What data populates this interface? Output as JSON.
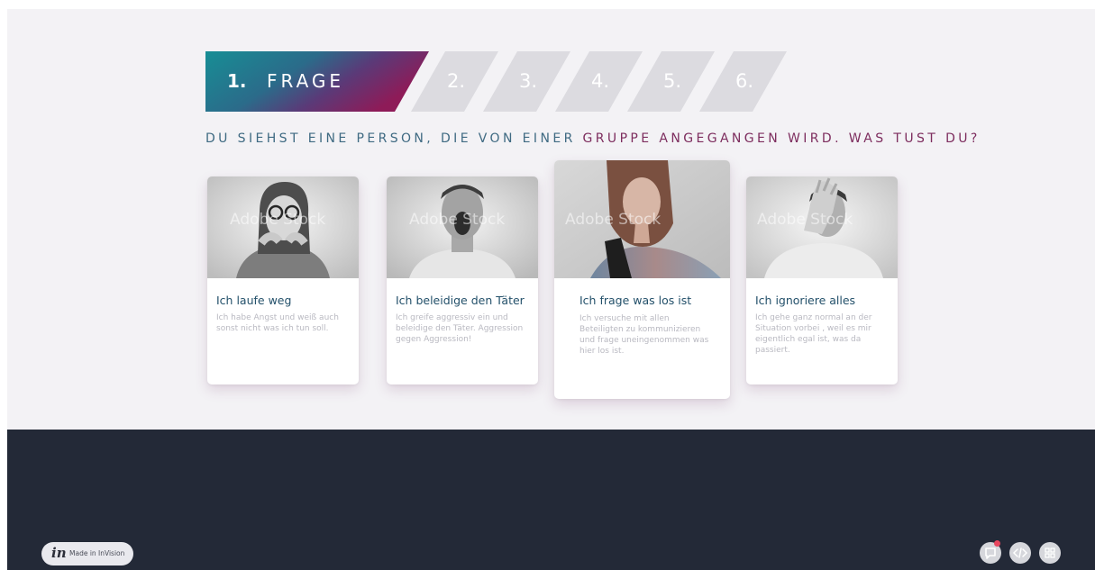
{
  "steps": {
    "active_number": "1.",
    "active_label": "FRAGE",
    "others": [
      "2.",
      "3.",
      "4.",
      "5.",
      "6."
    ]
  },
  "question": {
    "part1": "DU SIEHST EINE PERSON, DIE VON EINER ",
    "part2": "GRUPPE ANGEGANGEN WIRD. WAS TUST DU?"
  },
  "cards": [
    {
      "title": "Ich laufe weg",
      "desc": [
        "Ich habe Angst und weiß auch",
        "sonst nicht was ich tun soll."
      ]
    },
    {
      "title": "Ich beleidige den Täter",
      "desc": [
        "Ich greife aggressiv ein und",
        "beleidige den Täter. Aggression",
        "gegen Aggression!"
      ]
    },
    {
      "title": "Ich frage was los ist",
      "desc": [
        "Ich versuche mit allen",
        "Beteiligten zu kommunizieren",
        "und frage uneingenommen was",
        "hier los ist."
      ]
    },
    {
      "title": "Ich ignoriere alles",
      "desc": [
        "Ich gehe ganz normal an der",
        "Situation vorbei , weil es mir",
        "eigentlich egal ist, was da",
        "passiert."
      ]
    }
  ],
  "watermark": "Adobe Stock",
  "footer": {
    "invision_logo": "in",
    "invision_text": "Made in InVision"
  },
  "colors": {
    "gradient_start": "#1a8a93",
    "gradient_end": "#8a1d5a",
    "inactive_step": "#dcdbe0",
    "footer_bg": "#232937",
    "title_color": "#23506a",
    "notification_badge": "#e8475f"
  },
  "icons": [
    "comment-icon",
    "code-icon",
    "grid-icon"
  ]
}
